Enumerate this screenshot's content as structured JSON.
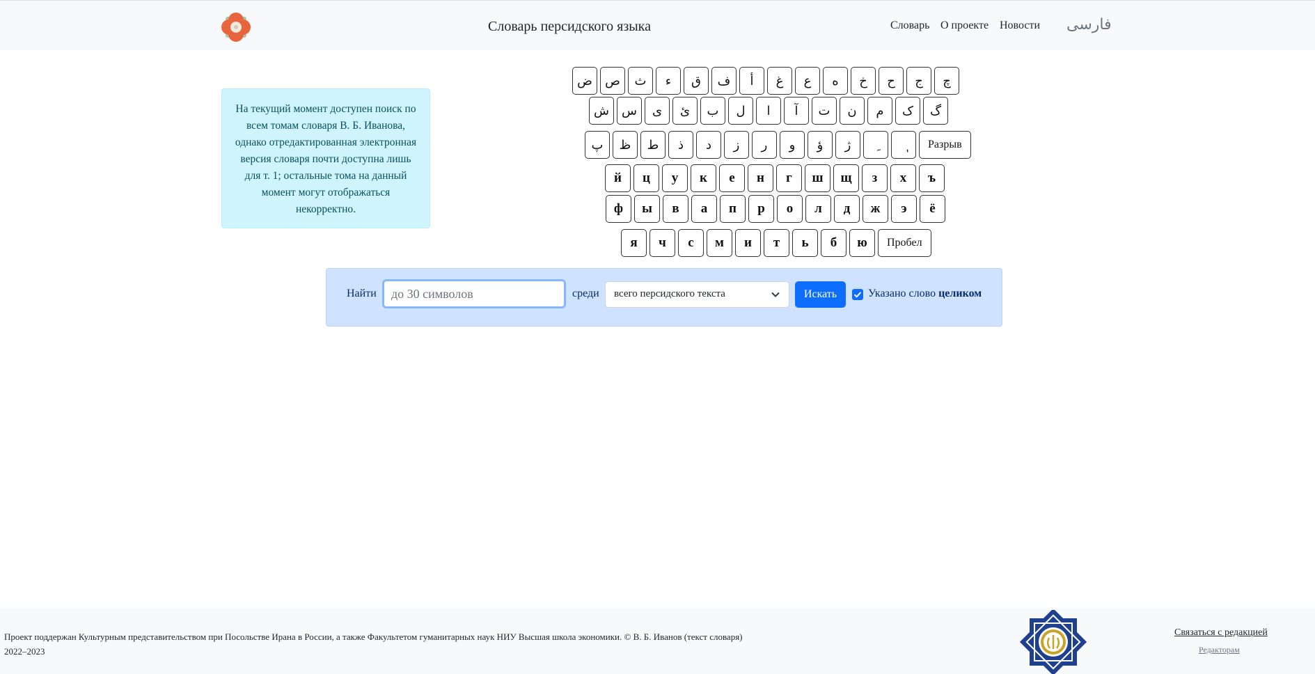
{
  "header": {
    "title": "Словарь персидского языка",
    "nav": [
      "Словарь",
      "О проекте",
      "Новости"
    ],
    "persian_link": "فارسی"
  },
  "info_text": "На текущий момент доступен поиск по всем томам словаря В. Б. Иванова, однако отредактированная электронная версия словаря почти доступна лишь для т. 1; остальные тома на данный момент могут отображаться некорректно.",
  "keyboard": {
    "row1": [
      "ض",
      "ص",
      "ث",
      "ء",
      "ق",
      "ف",
      "أ",
      "غ",
      "ع",
      "ه",
      "خ",
      "ح",
      "ج",
      "چ"
    ],
    "row2": [
      "ش",
      "س",
      "ی",
      "ئ",
      "ب",
      "ل",
      "ا",
      "آ",
      "ت",
      "ن",
      "م",
      "ک",
      "گ"
    ],
    "row3": [
      "پ",
      "ظ",
      "ط",
      "ذ",
      "د",
      "ز",
      "ر",
      "و",
      "ؤ",
      "ژ",
      "ِ",
      "ٖ"
    ],
    "row3_break": "Разрыв",
    "row4": [
      "й",
      "ц",
      "у",
      "к",
      "е",
      "н",
      "г",
      "ш",
      "щ",
      "з",
      "х",
      "ъ"
    ],
    "row5": [
      "ф",
      "ы",
      "в",
      "а",
      "п",
      "р",
      "о",
      "л",
      "д",
      "ж",
      "э",
      "ё"
    ],
    "row6": [
      "я",
      "ч",
      "с",
      "м",
      "и",
      "т",
      "ь",
      "б",
      "ю"
    ],
    "row6_space": "Пробел"
  },
  "search": {
    "find_label": "Найти",
    "placeholder": "до 30 символов",
    "among_label": "среди",
    "scope_selected": "всего персидского текста",
    "button": "Искать",
    "checkbox_checked": true,
    "checkbox_label": "Указано слово",
    "checkbox_label_bold": "целиком"
  },
  "footer": {
    "text_line1": "Проект поддержан Культурным представительством при Посольстве Ирана в России, а также Факультетом гуманитарных наук НИУ Высшая школа экономики. © В. Б. Иванов (текст словаря)",
    "text_line2": "2022–2023",
    "contact": "Связаться с редакцией",
    "editors": "Редакторам"
  },
  "colors": {
    "accent": "#0d6efd",
    "info_bg": "#cff4fc",
    "search_panel_bg": "#cfe2ff",
    "logo_orange": "#e8643c",
    "emblem_blue": "#1f3f8f"
  }
}
